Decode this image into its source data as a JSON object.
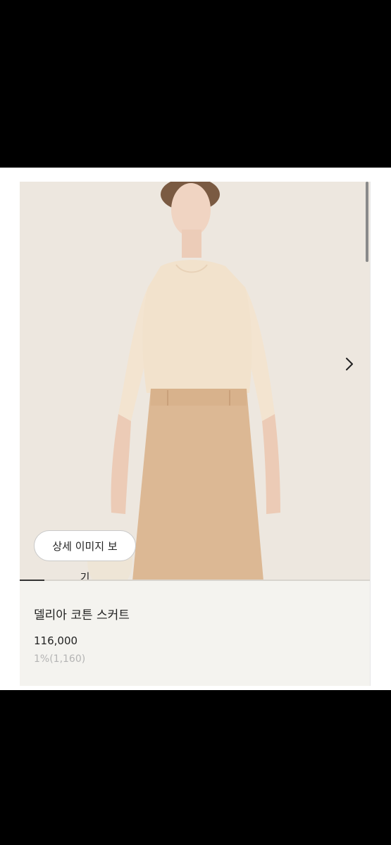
{
  "product": {
    "detail_button_label": "상세 이미지 보기",
    "name": "델리아 코튼 스커트",
    "price": "116,000",
    "points": "1%(1,160)"
  },
  "carousel": {
    "progress_fraction": 0.07,
    "next_icon": "chevron-right-icon"
  },
  "colors": {
    "card_background": "#f4f3ef",
    "photo_background": "#ece5dc",
    "skirt": "#dcb894",
    "top": "#f2e1cb",
    "points_text": "#b4b4b4"
  }
}
